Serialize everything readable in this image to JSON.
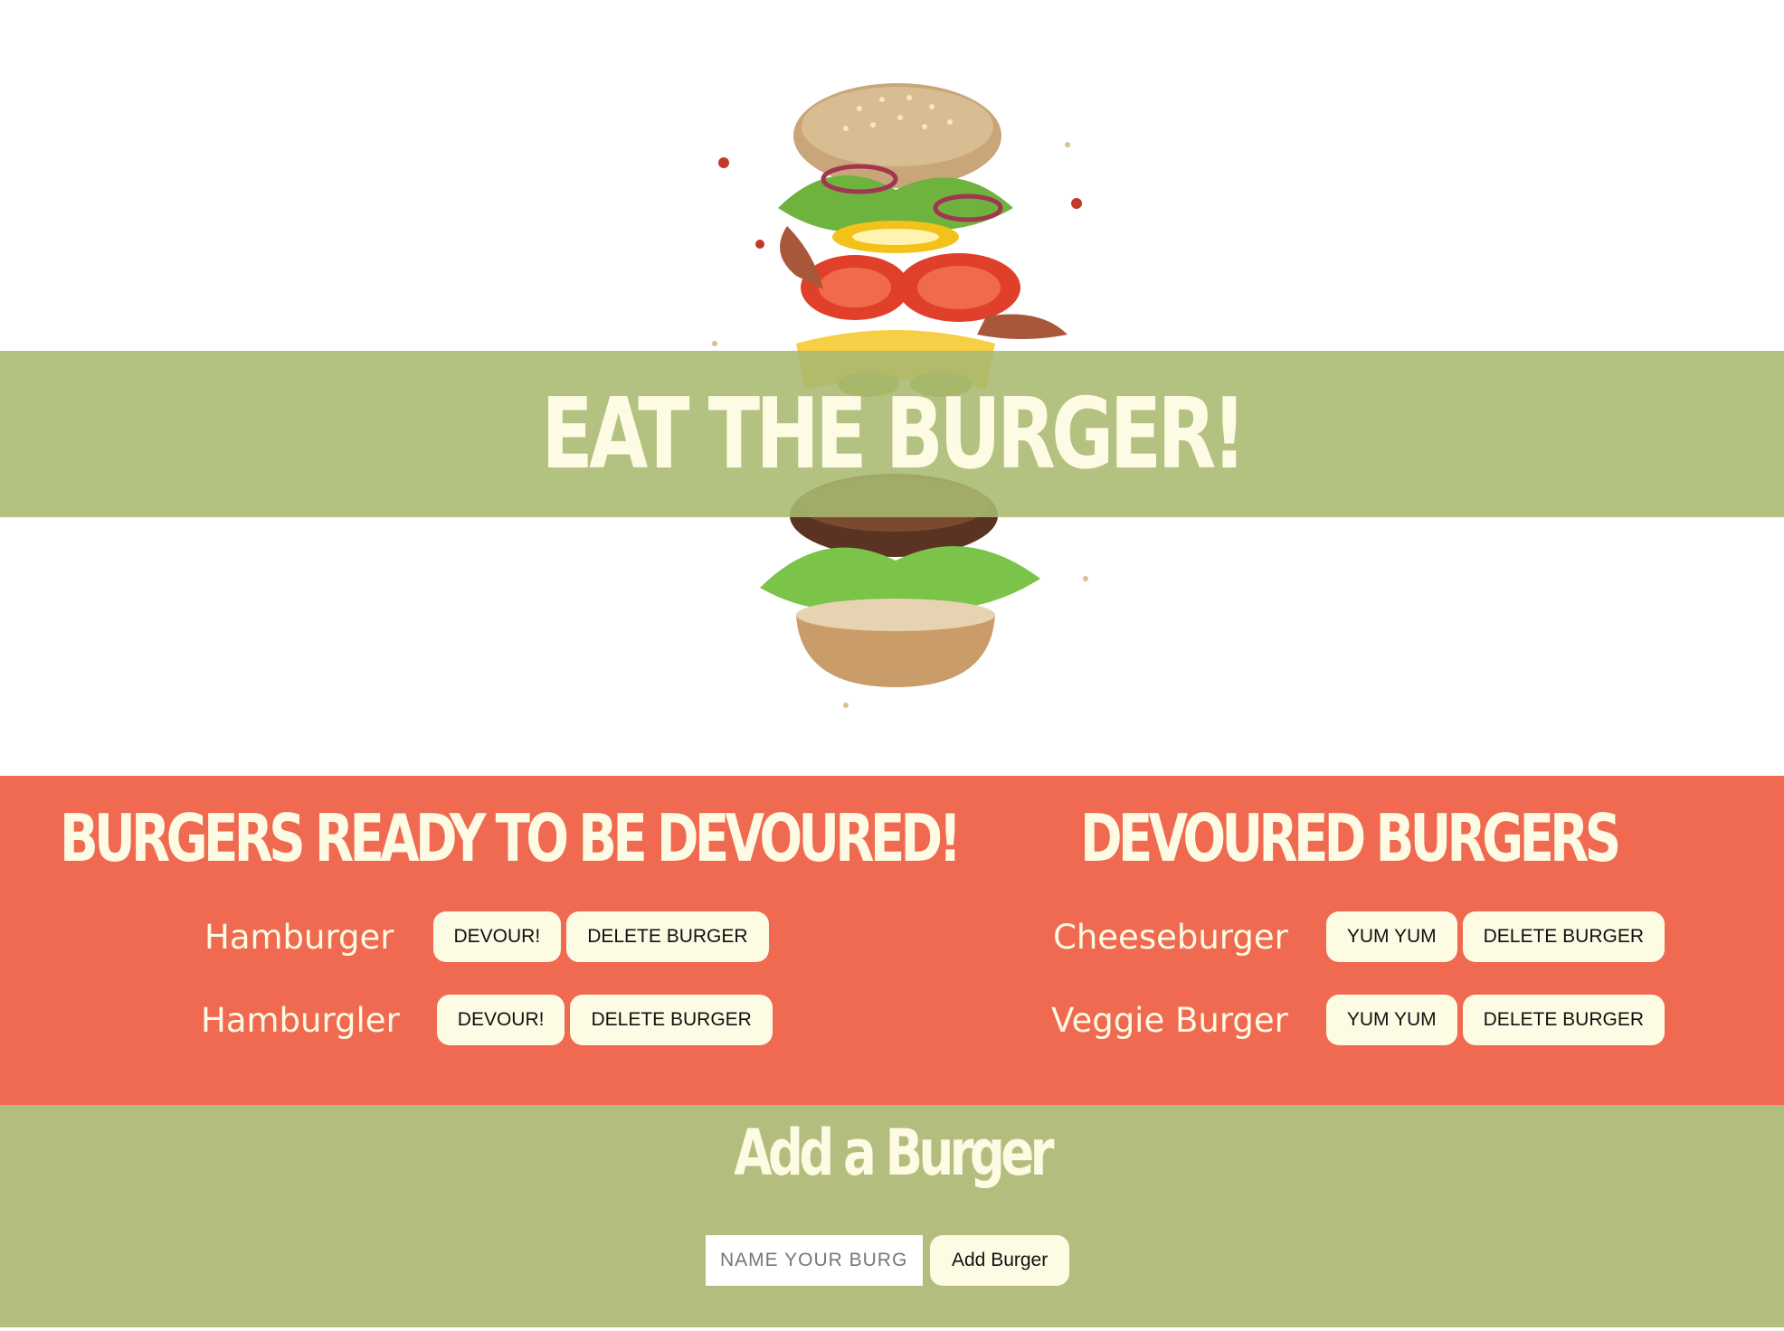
{
  "header": {
    "title": "EAT THE BURGER!"
  },
  "devour_section": {
    "title": "BURGERS READY TO BE DEVOURED!",
    "items": [
      {
        "name": "Hamburger",
        "devour_label": "DEVOUR!",
        "delete_label": "DELETE BURGER"
      },
      {
        "name": "Hamburgler",
        "devour_label": "DEVOUR!",
        "delete_label": "DELETE BURGER"
      }
    ]
  },
  "devoured_section": {
    "title": "DEVOURED BURGERS",
    "items": [
      {
        "name": "Cheeseburger",
        "yum_label": "YUM YUM",
        "delete_label": "DELETE BURGER"
      },
      {
        "name": "Veggie Burger",
        "yum_label": "YUM YUM",
        "delete_label": "DELETE BURGER"
      }
    ]
  },
  "add_section": {
    "title": "Add a Burger",
    "input_placeholder": "NAME YOUR BURGER",
    "input_value": "",
    "button_label": "Add Burger"
  },
  "colors": {
    "banner_green": "#b3be7e",
    "list_red": "#ef6a51",
    "cream": "#fdfbe3"
  }
}
